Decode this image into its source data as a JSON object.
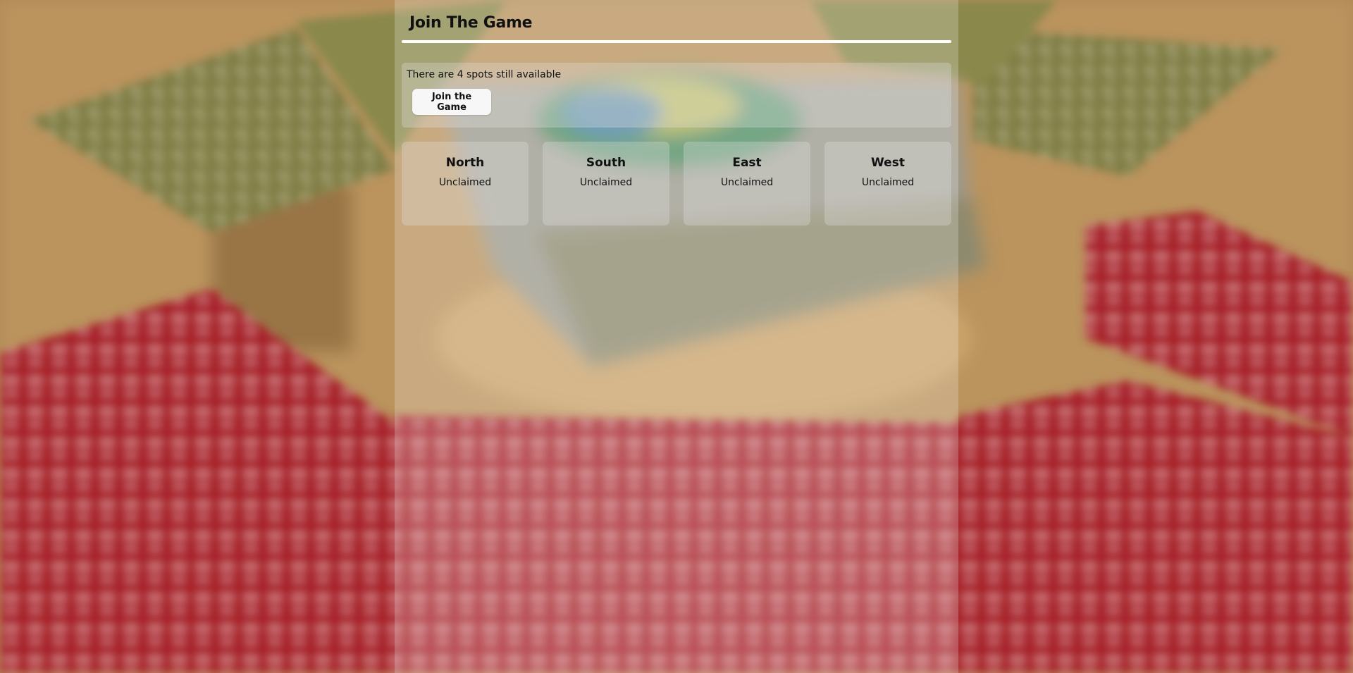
{
  "header": {
    "title": "Join The Game"
  },
  "availability": {
    "message": "There are 4 spots still available",
    "join_button_label": "Join the Game"
  },
  "seats": [
    {
      "name": "North",
      "status": "Unclaimed"
    },
    {
      "name": "South",
      "status": "Unclaimed"
    },
    {
      "name": "East",
      "status": "Unclaimed"
    },
    {
      "name": "West",
      "status": "Unclaimed"
    }
  ],
  "colors": {
    "table_wood": "#b08a55",
    "card_red": "#a8232c",
    "card_green": "#7d7a3e",
    "panel_tint": "rgba(255,255,255,0.22)"
  }
}
